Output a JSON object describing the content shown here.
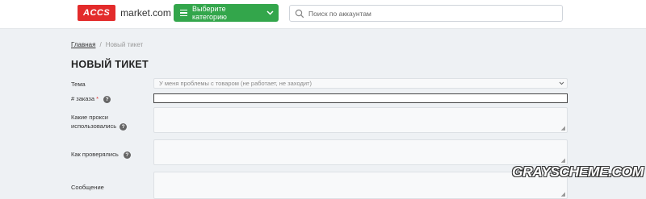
{
  "header": {
    "logo_badge": "ACCS",
    "logo_text": "market.com",
    "category_button": "Выберите категорию",
    "search_placeholder": "Поиск по аккаунтам"
  },
  "breadcrumb": {
    "home": "Главная",
    "separator": "/",
    "current": "Новый тикет"
  },
  "page_title": "НОВЫЙ ТИКЕТ",
  "form": {
    "topic_label": "Тема",
    "topic_value": "У меня проблемы с товаром (не работает, не заходит)",
    "order_label": "# заказа",
    "order_required": "*",
    "order_value": "",
    "proxies_label_line1": "Какие прокси",
    "proxies_label_line2": "использовались",
    "checked_label": "Как проверялись",
    "message_label": "Сообщение",
    "help_glyph": "?"
  },
  "watermark": "GRAYSCHEME.COM",
  "colors": {
    "brand_red": "#e32b2b",
    "category_green": "#33a64b",
    "page_background": "#eef1f4"
  },
  "icons": {
    "search": "magnifier",
    "menu": "hamburger",
    "dropdown": "chevron-down",
    "help": "question-circle"
  }
}
